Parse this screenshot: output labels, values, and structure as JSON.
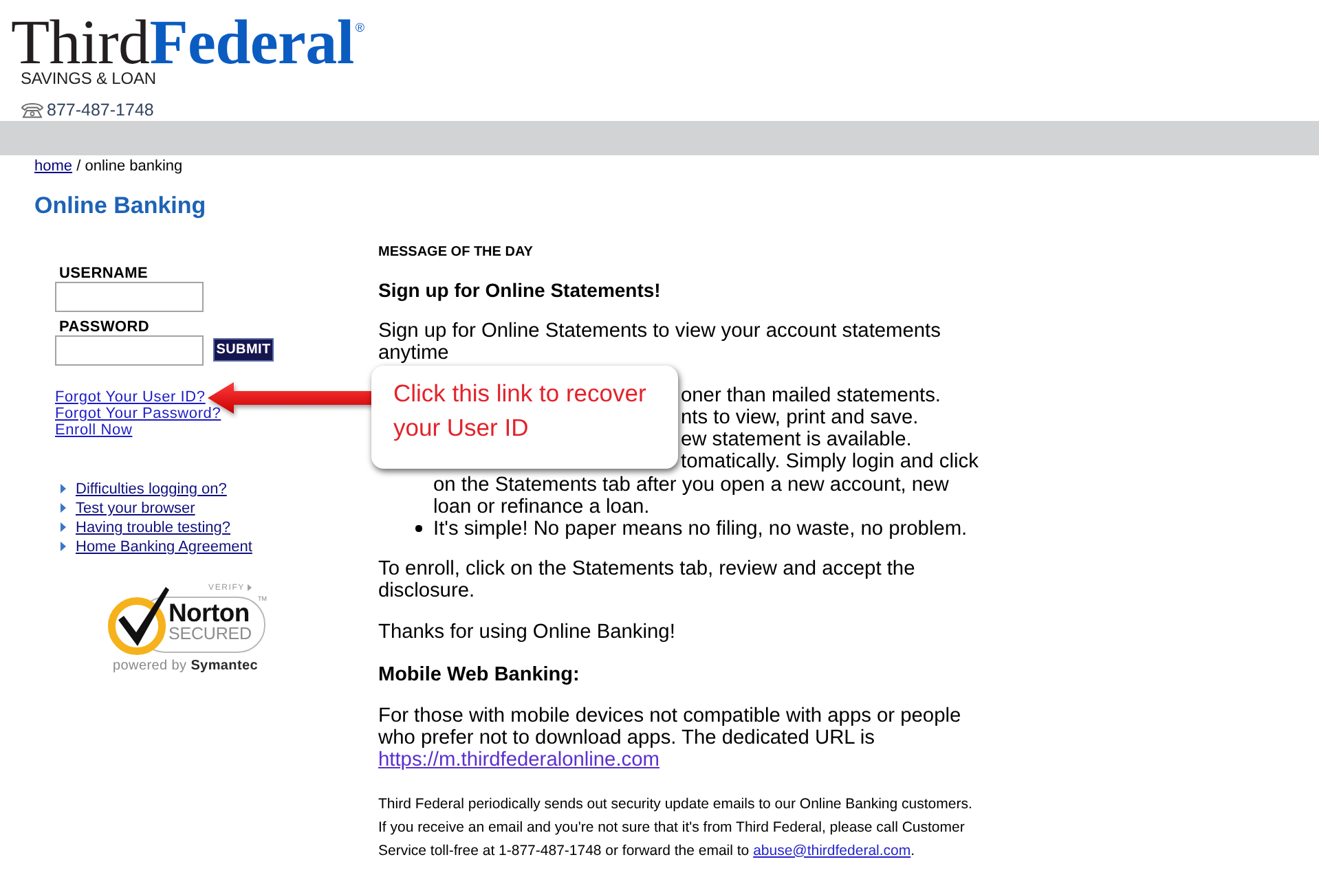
{
  "header": {
    "logo": {
      "first_word": "Third",
      "second_word": "Federal",
      "registered_mark": "®",
      "tagline": "SAVINGS & LOAN"
    },
    "phone": "877-487-1748"
  },
  "breadcrumb": {
    "link": "home",
    "current": "/ online banking"
  },
  "page_title": "Online Banking",
  "login": {
    "fields": [
      {
        "label": "USERNAME"
      },
      {
        "label": "PASSWORD"
      }
    ],
    "submit": "SUBMIT",
    "links": [
      "Forgot Your User ID?",
      "Forgot Your Password?",
      "Enroll Now"
    ]
  },
  "help_links": [
    "Difficulties logging on?",
    "Test your browser",
    "Having trouble testing?",
    "Home Banking Agreement"
  ],
  "security_seal": {
    "verify": "VERIFY",
    "trademark": "TM",
    "brand": "Norton",
    "status": "SECURED",
    "powered_by": "powered by",
    "vendor": "Symantec"
  },
  "message": {
    "heading": "MESSAGE OF THE DAY",
    "title": "Sign up for Online Statements!",
    "intro": "Sign up for Online Statements to view your account statements anytime",
    "bullets": [
      {
        "text": "oner than mailed statements.",
        "covered": true
      },
      {
        "text": "nts to view, print and save.",
        "covered": true
      },
      {
        "text": "ew statement is available.",
        "covered": true
      },
      {
        "text": "tomatically. Simply login and click on the Statements tab after you open a new account, new loan or refinance a loan.",
        "covered": true
      },
      {
        "text": "It's simple! No paper means no filing, no waste, no problem.",
        "covered": false
      }
    ],
    "enroll": "To enroll, click on the Statements tab, review and accept the disclosure.",
    "thanks": "Thanks for using Online Banking!",
    "mobile_title": "Mobile Web Banking:",
    "mobile_text": "For those with mobile devices not compatible with apps or people who prefer not to download apps. The dedicated URL is",
    "mobile_link": "https://m.thirdfederalonline.com",
    "notice": {
      "text": "Third Federal periodically sends out security update emails to our Online Banking customers. If you receive an email and you're not sure that it's from Third Federal, please call Customer Service toll-free at 1-877-487-1748 or forward the email to",
      "email": "abuse@thirdfederal.com",
      "end": "."
    }
  },
  "callout": {
    "text": "Click this link to recover your User ID"
  }
}
